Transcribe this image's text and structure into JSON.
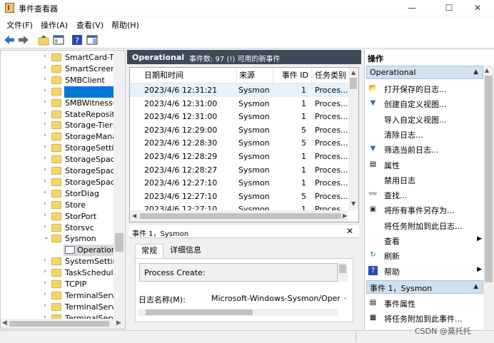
{
  "window": {
    "title": "事件查看器",
    "minimize": "—",
    "maximize": "☐",
    "close": "✕"
  },
  "menu": [
    "文件(F)",
    "操作(A)",
    "查看(V)",
    "帮助(H)"
  ],
  "toolbar": {
    "icons": [
      "back-icon",
      "forward-icon",
      "folder-up-icon",
      "console-tree-icon",
      "help-icon",
      "properties-pane-icon"
    ]
  },
  "tree": {
    "items": [
      {
        "label": "SmartCard-TP",
        "arrow": "›"
      },
      {
        "label": "SmartScreen",
        "arrow": "›"
      },
      {
        "label": "SMBClient",
        "arrow": "›"
      },
      {
        "label": "",
        "arrow": "›"
      },
      {
        "label": "SMBWitnessC",
        "arrow": "›"
      },
      {
        "label": "StateReposito",
        "arrow": "›"
      },
      {
        "label": "Storage-Tierir",
        "arrow": "›"
      },
      {
        "label": "StorageManag",
        "arrow": "›"
      },
      {
        "label": "StorageSetting",
        "arrow": "›"
      },
      {
        "label": "StorageSpace",
        "arrow": "›"
      },
      {
        "label": "StorageSpace",
        "arrow": "›"
      },
      {
        "label": "StorageSpace",
        "arrow": "›"
      },
      {
        "label": "StorDiag",
        "arrow": "›"
      },
      {
        "label": "Store",
        "arrow": "›"
      },
      {
        "label": "StorPort",
        "arrow": "›"
      },
      {
        "label": "Storsvc",
        "arrow": "›"
      },
      {
        "label": "Sysmon",
        "arrow": "⌄"
      },
      {
        "label": "Operationa",
        "arrow": ""
      },
      {
        "label": "SystemSetting",
        "arrow": "›"
      },
      {
        "label": "TaskSchedule",
        "arrow": "›"
      },
      {
        "label": "TCPIP",
        "arrow": "›"
      },
      {
        "label": "TerminalServi",
        "arrow": "›"
      },
      {
        "label": "TerminalServi",
        "arrow": "›"
      },
      {
        "label": "TerminalServi",
        "arrow": "›"
      }
    ]
  },
  "log": {
    "name": "Operational",
    "summary": "事件数: 97 (!) 可用的新事件"
  },
  "table": {
    "columns": [
      "日期和时间",
      "来源",
      "事件 ID",
      "任务类别"
    ],
    "rows": [
      {
        "time": "2023/4/6 12:31:21",
        "source": "Sysmon",
        "id": "1",
        "task": "Proces..."
      },
      {
        "time": "2023/4/6 12:31:00",
        "source": "Sysmon",
        "id": "1",
        "task": "Proces..."
      },
      {
        "time": "2023/4/6 12:31:00",
        "source": "Sysmon",
        "id": "1",
        "task": "Proces..."
      },
      {
        "time": "2023/4/6 12:29:00",
        "source": "Sysmon",
        "id": "5",
        "task": "Proces..."
      },
      {
        "time": "2023/4/6 12:28:30",
        "source": "Sysmon",
        "id": "5",
        "task": "Proces..."
      },
      {
        "time": "2023/4/6 12:28:29",
        "source": "Sysmon",
        "id": "1",
        "task": "Proces..."
      },
      {
        "time": "2023/4/6 12:28:27",
        "source": "Sysmon",
        "id": "1",
        "task": "Proces..."
      },
      {
        "time": "2023/4/6 12:27:10",
        "source": "Sysmon",
        "id": "1",
        "task": "Proces..."
      },
      {
        "time": "2023/4/6 12:27:10",
        "source": "Sysmon",
        "id": "5",
        "task": "Proces..."
      },
      {
        "time": "2023/4/6 12:27:10",
        "source": "Sysmon",
        "id": "1",
        "task": "Proces..."
      }
    ]
  },
  "detail": {
    "title": "事件 1，Sysmon",
    "close": "✕",
    "tabs": [
      "常规",
      "详细信息"
    ],
    "message": "Process Create:",
    "logname_label": "日志名称(M):",
    "logname_value": "Microsoft-Windows-Sysmon/Operatic"
  },
  "actions": {
    "header": "操作",
    "sections": [
      {
        "title": "Operational",
        "items": [
          {
            "label": "打开保存的日志...",
            "icon": "open-log-icon",
            "glyph": "📂",
            "submenu": false
          },
          {
            "label": "创建自定义视图...",
            "icon": "filter-icon",
            "glyph": "▼",
            "submenu": false
          },
          {
            "label": "导入自定义视图...",
            "icon": "",
            "glyph": "",
            "submenu": false
          },
          {
            "label": "清除日志...",
            "icon": "",
            "glyph": "",
            "submenu": false
          },
          {
            "label": "筛选当前日志...",
            "icon": "filter-icon",
            "glyph": "▼",
            "submenu": false
          },
          {
            "label": "属性",
            "icon": "properties-icon",
            "glyph": "▤",
            "submenu": false
          },
          {
            "label": "禁用日志",
            "icon": "",
            "glyph": "",
            "submenu": false
          },
          {
            "label": "查找...",
            "icon": "binoculars-icon",
            "glyph": "👓",
            "submenu": false
          },
          {
            "label": "将所有事件另存为...",
            "icon": "save-icon",
            "glyph": "▣",
            "submenu": false
          },
          {
            "label": "将任务附加到此日志...",
            "icon": "",
            "glyph": "",
            "submenu": false
          },
          {
            "label": "查看",
            "icon": "",
            "glyph": "",
            "submenu": true
          },
          {
            "label": "刷新",
            "icon": "refresh-icon",
            "glyph": "↻",
            "submenu": false
          },
          {
            "label": "帮助",
            "icon": "help-icon",
            "glyph": "?",
            "submenu": true
          }
        ]
      },
      {
        "title": "事件 1，Sysmon",
        "items": [
          {
            "label": "事件属性",
            "icon": "event-properties-icon",
            "glyph": "▤",
            "submenu": false
          },
          {
            "label": "将任务附加到此事件...",
            "icon": "attach-task-icon",
            "glyph": "▦",
            "submenu": false
          }
        ]
      }
    ]
  },
  "watermark": "CSDN @莫托托",
  "colors": {
    "header": "#3c4a5a",
    "section": "#cfe0f0",
    "selected": "#0078d7",
    "folder": "#f4d56a"
  }
}
